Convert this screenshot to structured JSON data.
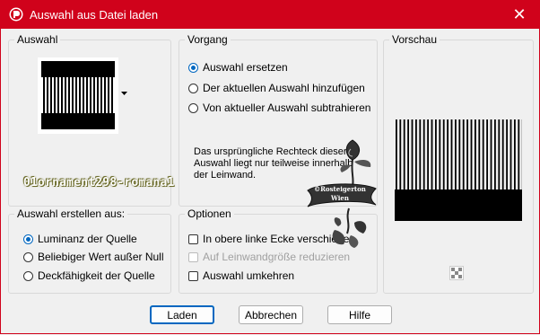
{
  "window": {
    "title": "Auswahl aus Datei laden",
    "close_glyph": "✕"
  },
  "auswahl": {
    "legend": "Auswahl"
  },
  "vorgang": {
    "legend": "Vorgang",
    "options": [
      {
        "label": "Auswahl ersetzen",
        "selected": true
      },
      {
        "label": "Der aktuellen Auswahl hinzufügen",
        "selected": false
      },
      {
        "label": "Von aktueller Auswahl subtrahieren",
        "selected": false
      }
    ],
    "info": "Das ursprüngliche Rechteck dieser Auswahl liegt nur teilweise innerhalb der Leinwand."
  },
  "vorschau": {
    "legend": "Vorschau"
  },
  "erstellen": {
    "legend": "Auswahl erstellen aus:",
    "options": [
      {
        "label": "Luminanz der Quelle",
        "selected": true
      },
      {
        "label": "Beliebiger Wert außer Null",
        "selected": false
      },
      {
        "label": "Deckfähigkeit der Quelle",
        "selected": false
      }
    ]
  },
  "optionen": {
    "legend": "Optionen",
    "checks": [
      {
        "label": "In obere linke Ecke verschieben",
        "checked": false,
        "disabled": false
      },
      {
        "label": "Auf Leinwandgröße reduzieren",
        "checked": false,
        "disabled": true
      },
      {
        "label": "Auswahl umkehren",
        "checked": false,
        "disabled": false
      }
    ]
  },
  "buttons": {
    "load": "Laden",
    "cancel": "Abbrechen",
    "help": "Hilfe"
  },
  "overlay": {
    "watermark": "01ornament298-romana1",
    "stamp_line1": "©Rosteigerton",
    "stamp_line2": "Wien"
  },
  "colors": {
    "titlebar": "#d0021b",
    "accent": "#0067c0"
  },
  "icons": {
    "app": "paintshop-icon",
    "dropdown": "dropdown-arrow-icon",
    "transparency": "checkerboard-icon"
  }
}
